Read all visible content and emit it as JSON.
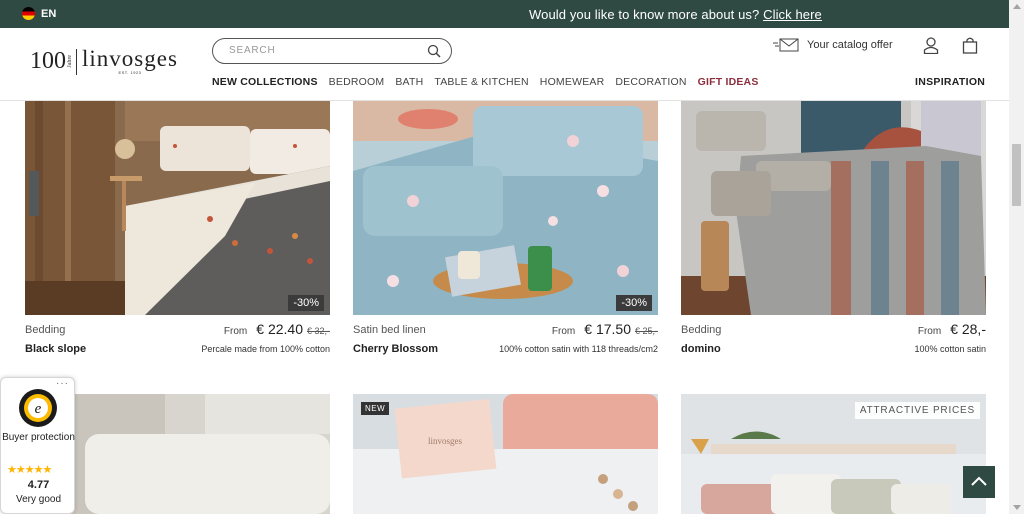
{
  "topbar": {
    "language": "EN",
    "announcement": "Would you like to know more about us?",
    "link": "Click here"
  },
  "logo": {
    "number": "100",
    "jahre": "Jahre",
    "name": "linvosges",
    "est": "EST. 1923"
  },
  "search": {
    "placeholder": "SEARCH"
  },
  "header": {
    "catalog_label": "Your catalog offer"
  },
  "nav": {
    "items": [
      "NEW COLLECTIONS",
      "BEDROOM",
      "BATH",
      "TABLE & KITCHEN",
      "HOMEWEAR",
      "DECORATION",
      "GIFT IDEAS"
    ],
    "inspiration": "INSPIRATION"
  },
  "products": [
    {
      "category": "Bedding",
      "name": "Black slope",
      "from": "From",
      "price": "€ 22.40",
      "old_price": "€ 32,-",
      "description": "Percale made from 100% cotton",
      "discount": "-30%"
    },
    {
      "category": "Satin bed linen",
      "name": "Cherry Blossom",
      "from": "From",
      "price": "€ 17.50",
      "old_price": "€ 25,-",
      "description": "100% cotton satin with 118 threads/cm2",
      "discount": "-30%"
    },
    {
      "category": "Bedding",
      "name": "domino",
      "from": "From",
      "price": "€ 28,-",
      "description": "100% cotton satin"
    }
  ],
  "row2": {
    "new_tag": "NEW",
    "attractive": "ATTRACTIVE PRICES",
    "pillow_brand": "linvosges"
  },
  "trust": {
    "more": "···",
    "protection": "Buyer protection",
    "stars": "★★★★★",
    "rating": "4.77",
    "verdict": "Very good"
  },
  "colors": {
    "topbar": "#2f4a43",
    "gift": "#8c2f3f"
  }
}
